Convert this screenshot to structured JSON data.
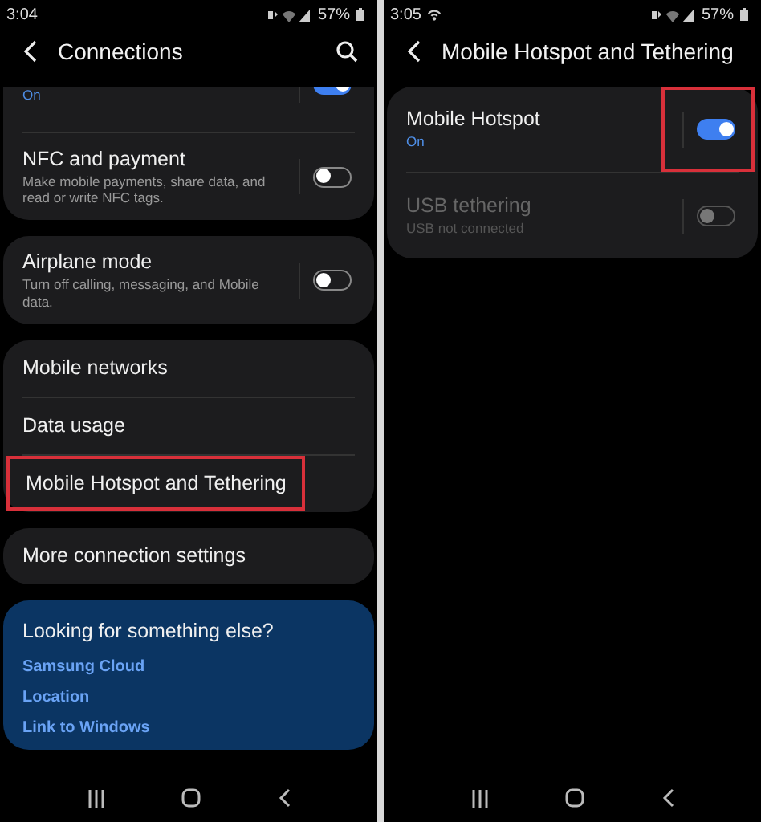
{
  "screens": [
    {
      "status_bar": {
        "time": "3:04",
        "battery": "57%",
        "hotspot_active": false
      },
      "header": {
        "title": "Connections",
        "search": true
      },
      "cards": [
        {
          "clipped_top": true,
          "items": [
            {
              "kind": "toggle",
              "subtitle": "On",
              "accent": true,
              "on": true,
              "disabled": false,
              "partial": true,
              "highlighted": false
            },
            {
              "kind": "toggle",
              "title": "NFC and payment",
              "subtitle": "Make mobile payments, share data, and read or write NFC tags.",
              "accent": false,
              "on": false,
              "disabled": false,
              "partial": false,
              "highlighted": false
            }
          ]
        },
        {
          "items": [
            {
              "kind": "toggle",
              "title": "Airplane mode",
              "subtitle": "Turn off calling, messaging, and Mobile data.",
              "accent": false,
              "on": false,
              "disabled": false,
              "partial": false,
              "highlighted": false
            }
          ]
        },
        {
          "items": [
            {
              "kind": "link",
              "title": "Mobile networks",
              "highlighted": false
            },
            {
              "kind": "link",
              "title": "Data usage",
              "highlighted": false
            },
            {
              "kind": "link",
              "title": "Mobile Hotspot and Tethering",
              "highlighted": true
            }
          ]
        },
        {
          "items": [
            {
              "kind": "link",
              "title": "More connection settings",
              "highlighted": false
            }
          ]
        }
      ],
      "suggestions": {
        "title": "Looking for something else?",
        "links": [
          "Samsung Cloud",
          "Location",
          "Link to Windows"
        ]
      }
    },
    {
      "status_bar": {
        "time": "3:05",
        "battery": "57%",
        "hotspot_active": true
      },
      "header": {
        "title": "Mobile Hotspot and Tethering",
        "search": false
      },
      "cards": [
        {
          "items": [
            {
              "kind": "toggle",
              "title": "Mobile Hotspot",
              "subtitle": "On",
              "accent": true,
              "on": true,
              "disabled": false,
              "partial": false,
              "highlighted": true
            },
            {
              "kind": "toggle",
              "title": "USB tethering",
              "subtitle": "USB not connected",
              "accent": false,
              "on": false,
              "disabled": true,
              "partial": false,
              "highlighted": false
            }
          ]
        }
      ]
    }
  ]
}
